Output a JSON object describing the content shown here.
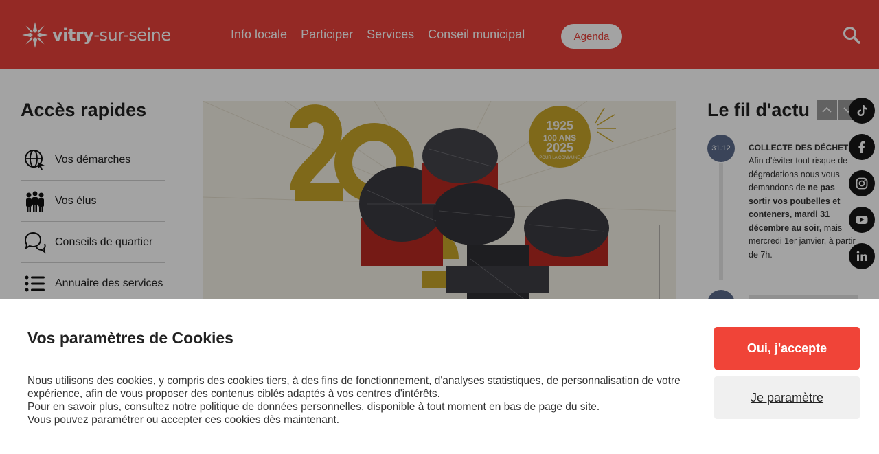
{
  "header": {
    "logo_bold": "vitry",
    "logo_light": "-sur-seine",
    "nav": [
      "Info locale",
      "Participer",
      "Services",
      "Conseil municipal"
    ],
    "agenda_label": "Agenda",
    "bg_color": "#e8403a"
  },
  "quick_access": {
    "title": "Accès rapides",
    "items": [
      {
        "label": "Vos démarches",
        "icon": "globe-cursor-icon"
      },
      {
        "label": "Vos élus",
        "icon": "people-icon"
      },
      {
        "label": "Conseils de quartier",
        "icon": "chat-bubbles-icon"
      },
      {
        "label": "Annuaire des services",
        "icon": "list-icon"
      }
    ]
  },
  "hero": {
    "badge_top": "1925",
    "badge_mid": "100 ANS",
    "badge_bottom": "2025",
    "badge_caption": "POUR LA COMMUNE"
  },
  "news": {
    "title": "Le fil d'actu",
    "items": [
      {
        "time": "31.12",
        "headline": "COLLECTE DES DÉCHETS",
        "text_1": "Afin d'éviter tout risque de dégradations nous vous demandons de ",
        "text_bold": "ne pas sortir vos poubelles et conteners, mardi 31 décembre au soir,",
        "text_2": " mais mercredi 1er janvier, à partir de 7h."
      }
    ]
  },
  "social": [
    "tiktok-icon",
    "facebook-icon",
    "instagram-icon",
    "youtube-icon",
    "linkedin-icon"
  ],
  "cookie": {
    "title": "Vos paramètres de Cookies",
    "line1": "Nous utilisons des cookies, y compris des cookies tiers, à des fins de fonctionnement, d'analyses statistiques, de personnalisation de votre expérience, afin de vous proposer des contenus ciblés adaptés à vos centres d'intérêts.",
    "line2": "Pour en savoir plus, consultez notre politique de données personnelles, disponible à tout moment en bas de page du site.",
    "line3": "Vous pouvez paramétrer ou accepter ces cookies dès maintenant.",
    "accept_label": "Oui, j'accepte",
    "settings_label": "Je paramètre",
    "accept_color": "#f04438"
  }
}
